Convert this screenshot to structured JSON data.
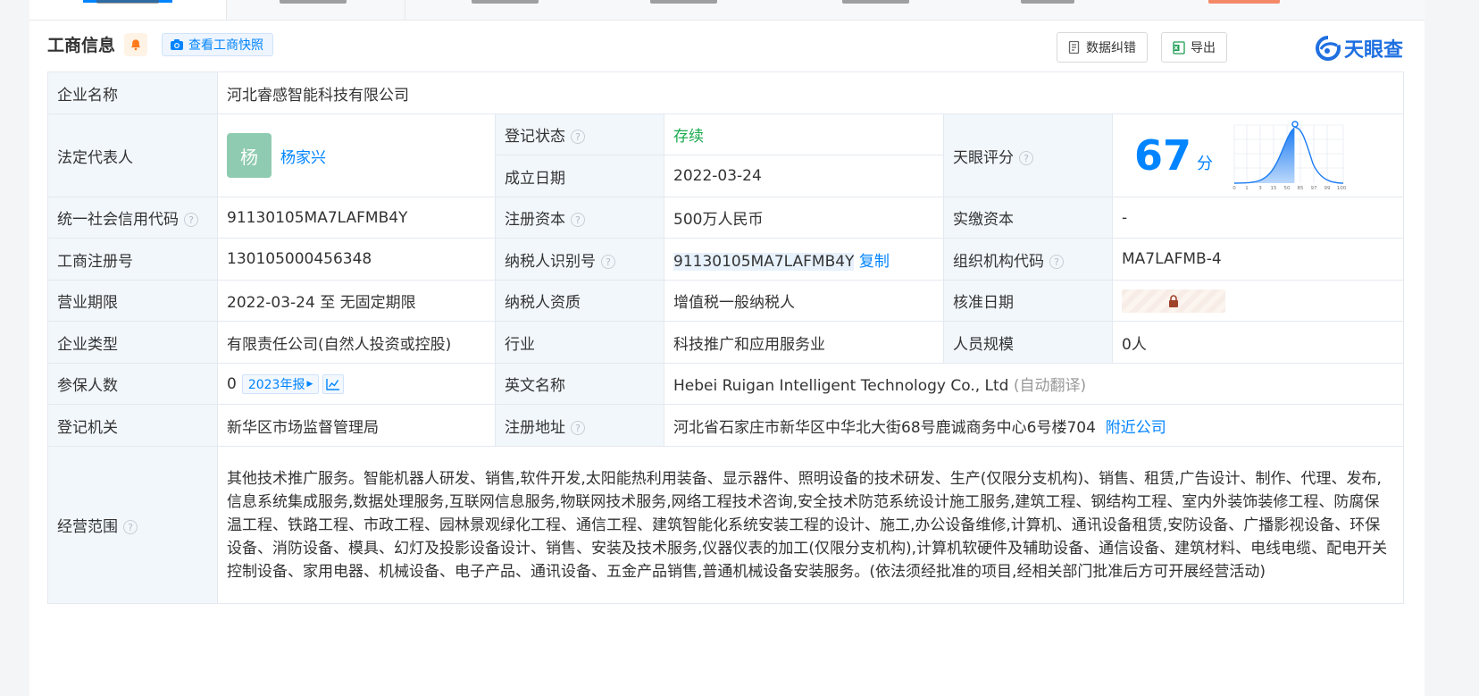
{
  "header": {
    "section_title": "工商信息",
    "snapshot_label": "查看工商快照",
    "correct_label": "数据纠错",
    "export_label": "导出",
    "logo_text": "天眼查"
  },
  "company": {
    "name_label": "企业名称",
    "name_value": "河北睿感智能科技有限公司",
    "legal_rep_label": "法定代表人",
    "legal_rep_avatar": "杨",
    "legal_rep_name": "杨家兴",
    "reg_status_label": "登记状态",
    "reg_status_value": "存续",
    "found_date_label": "成立日期",
    "found_date_value": "2022-03-24",
    "score_label": "天眼评分",
    "score_value": "67",
    "score_unit": "分",
    "score_ticks": [
      "0",
      "1",
      "3",
      "15",
      "50",
      "85",
      "97",
      "99",
      "100"
    ],
    "credit_code_label": "统一社会信用代码",
    "credit_code_value": "91130105MA7LAFMB4Y",
    "reg_capital_label": "注册资本",
    "reg_capital_value": "500万人民币",
    "paid_capital_label": "实缴资本",
    "paid_capital_value": "-",
    "reg_no_label": "工商注册号",
    "reg_no_value": "130105000456348",
    "tax_id_label": "纳税人识别号",
    "tax_id_value": "91130105MA7LAFMB4Y",
    "copy_label": "复制",
    "org_code_label": "组织机构代码",
    "org_code_value": "MA7LAFMB-4",
    "term_label": "营业期限",
    "term_value": "2022-03-24 至 无固定期限",
    "tax_qual_label": "纳税人资质",
    "tax_qual_value": "增值税一般纳税人",
    "approve_label": "核准日期",
    "type_label": "企业类型",
    "type_value": "有限责任公司(自然人投资或控股)",
    "industry_label": "行业",
    "industry_value": "科技推广和应用服务业",
    "staff_label": "人员规模",
    "staff_value": "0人",
    "insured_label": "参保人数",
    "insured_value": "0",
    "report_label": "2023年报",
    "english_label": "英文名称",
    "english_value": "Hebei Ruigan Intelligent Technology Co., Ltd",
    "auto_translate": "(自动翻译)",
    "authority_label": "登记机关",
    "authority_value": "新华区市场监督管理局",
    "address_label": "注册地址",
    "address_value": "河北省石家庄市新华区中华北大街68号鹿诚商务中心6号楼704",
    "nearby_label": "附近公司",
    "scope_label": "经营范围",
    "scope_value": "其他技术推广服务。智能机器人研发、销售,软件开发,太阳能热利用装备、显示器件、照明设备的技术研发、生产(仅限分支机构)、销售、租赁,广告设计、制作、代理、发布,信息系统集成服务,数据处理服务,互联网信息服务,物联网技术服务,网络工程技术咨询,安全技术防范系统设计施工服务,建筑工程、钢结构工程、室内外装饰装修工程、防腐保温工程、铁路工程、市政工程、园林景观绿化工程、通信工程、建筑智能化系统安装工程的设计、施工,办公设备维修,计算机、通讯设备租赁,安防设备、广播影视设备、环保设备、消防设备、模具、幻灯及投影设备设计、销售、安装及技术服务,仪器仪表的加工(仅限分支机构),计算机软硬件及辅助设备、通信设备、建筑材料、电线电缆、配电开关控制设备、家用电器、机械设备、电子产品、通讯设备、五金产品销售,普通机械设备安装服务。(依法须经批准的项目,经相关部门批准后方可开展经营活动)"
  },
  "colors": {
    "accent": "#0084ff",
    "status_green": "#1aab4e",
    "label_bg": "#f2f7fc"
  }
}
